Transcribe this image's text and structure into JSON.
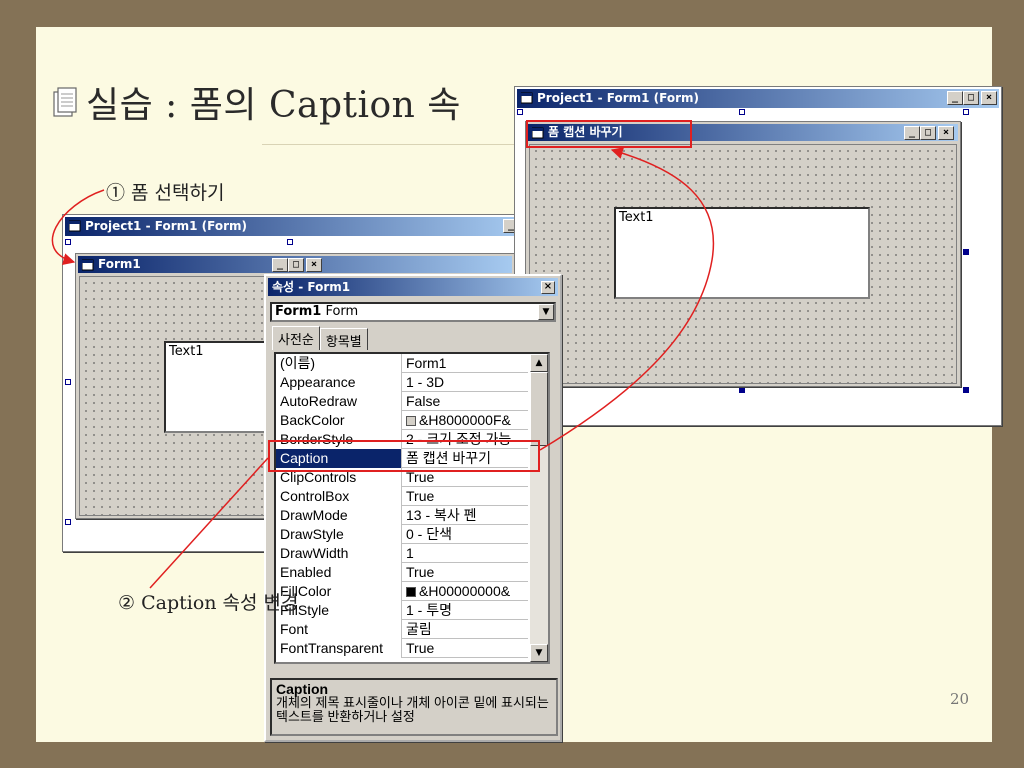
{
  "slide": {
    "title": "실습 : 폼의 Caption 속",
    "step1": "① 폼 선택하기",
    "step2": "② Caption 속성 변경",
    "page_number": "20"
  },
  "left_window": {
    "title": "Project1 - Form1 (Form)",
    "form_title": "Form1",
    "textbox": "Text1"
  },
  "right_window": {
    "title": "Project1 - Form1 (Form)",
    "form_title": "폼 캡션 바꾸기",
    "textbox": "Text1"
  },
  "properties": {
    "title": "속성 - Form1",
    "object_name": "Form1",
    "object_type": "Form",
    "tabs": [
      "사전순",
      "항목별"
    ],
    "rows": [
      {
        "name": "(이름)",
        "value": "Form1"
      },
      {
        "name": "Appearance",
        "value": "1 - 3D"
      },
      {
        "name": "AutoRedraw",
        "value": "False"
      },
      {
        "name": "BackColor",
        "value": "&H8000000F&",
        "swatch": "#d4d0c8"
      },
      {
        "name": "BorderStyle",
        "value": "2 - 크기 조정 가능"
      },
      {
        "name": "Caption",
        "value": "폼 캡션 바꾸기",
        "selected": true
      },
      {
        "name": "ClipControls",
        "value": "True"
      },
      {
        "name": "ControlBox",
        "value": "True"
      },
      {
        "name": "DrawMode",
        "value": "13 - 복사 펜"
      },
      {
        "name": "DrawStyle",
        "value": "0 - 단색"
      },
      {
        "name": "DrawWidth",
        "value": "1"
      },
      {
        "name": "Enabled",
        "value": "True"
      },
      {
        "name": "FillColor",
        "value": "&H00000000&",
        "swatch": "#000000"
      },
      {
        "name": "FillStyle",
        "value": "1 - 투명"
      },
      {
        "name": "Font",
        "value": "굴림"
      },
      {
        "name": "FontTransparent",
        "value": "True"
      }
    ],
    "description_title": "Caption",
    "description_text": "개체의 제목 표시줄이나 개체 아이콘 밑에 표시되는 텍스트를 반환하거나 설정"
  },
  "colors": {
    "background": "#847256",
    "slide": "#FCFAE2",
    "titlebar": "#0a246a",
    "highlight": "#e02020",
    "selection": "#0a246a"
  },
  "icons": [
    "document-icon",
    "form-icon",
    "minimize-icon",
    "maximize-icon",
    "close-icon",
    "dropdown-arrow-icon"
  ]
}
